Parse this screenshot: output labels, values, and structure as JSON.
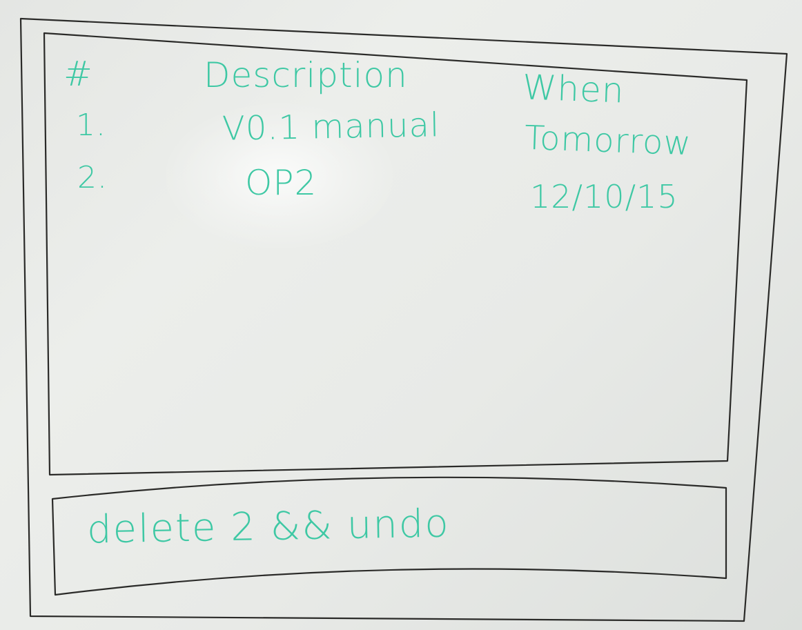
{
  "table": {
    "headers": {
      "number": "#",
      "description": "Description",
      "when": "When"
    },
    "rows": [
      {
        "number": "1.",
        "description": "V0.1 manual",
        "when": "Tomorrow"
      },
      {
        "number": "2.",
        "description": "OP2",
        "when": "12/10/15"
      }
    ]
  },
  "command_box": {
    "value": "delete 2 && undo"
  },
  "colors": {
    "ink": "#3ec8a4",
    "frame": "#2a2a28",
    "board": "#e8eae7"
  }
}
